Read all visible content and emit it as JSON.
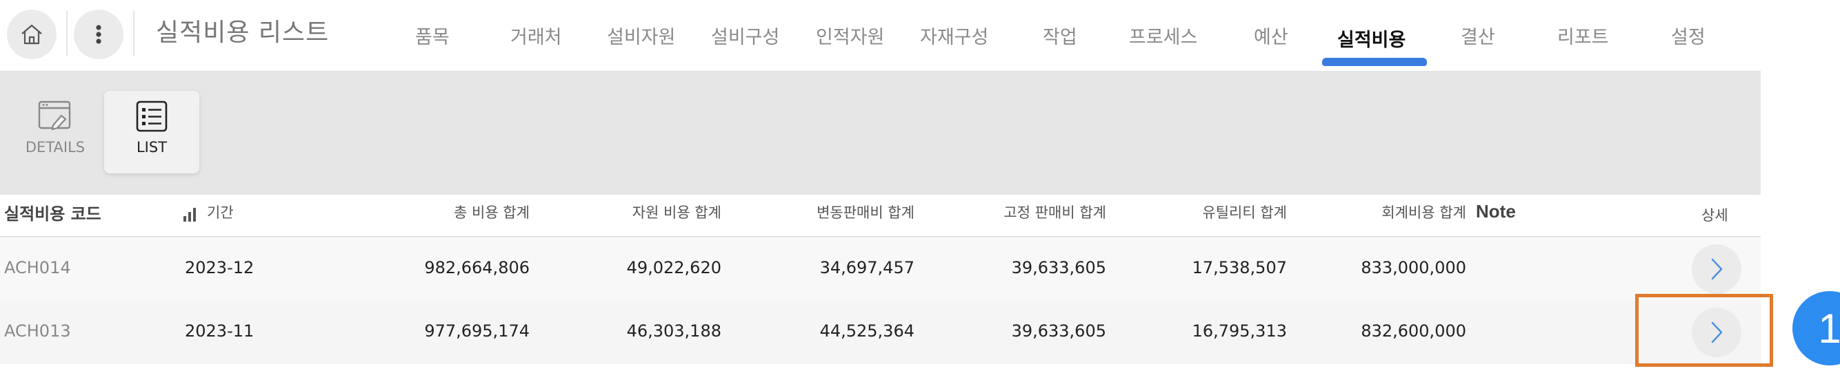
{
  "header": {
    "title": "실적비용 리스트",
    "home_icon": "home-icon",
    "menu_icon": "more-vertical-icon"
  },
  "nav": {
    "tabs": [
      {
        "label": "품목"
      },
      {
        "label": "거래처"
      },
      {
        "label": "설비자원"
      },
      {
        "label": "설비구성"
      },
      {
        "label": "인적자원"
      },
      {
        "label": "자재구성"
      },
      {
        "label": "작업"
      },
      {
        "label": "프로세스"
      },
      {
        "label": "예산"
      },
      {
        "label": "실적비용",
        "active": true
      },
      {
        "label": "결산"
      },
      {
        "label": "리포트"
      },
      {
        "label": "설정"
      }
    ],
    "accent_color": "#3a7be0"
  },
  "toolbar": {
    "details_label": "DETAILS",
    "list_label": "LIST",
    "details_icon": "details-window-icon",
    "list_icon": "list-icon",
    "active_view": "LIST"
  },
  "table": {
    "columns": {
      "code": "실적비용 코드",
      "period": "기간",
      "total": "총 비용 합계",
      "resource": "자원 비용 합계",
      "variable_sales": "변동판매비 합계",
      "fixed_sales": "고정 판매비 합계",
      "utility": "유틸리티 합계",
      "accounting": "회계비용 합계",
      "note": "Note",
      "detail": "상세"
    },
    "rows": [
      {
        "code": "ACH014",
        "period": "2023-12",
        "total": "982,664,806",
        "resource": "49,022,620",
        "variable_sales": "34,697,457",
        "fixed_sales": "39,633,605",
        "utility": "17,538,507",
        "accounting": "833,000,000"
      },
      {
        "code": "ACH013",
        "period": "2023-11",
        "total": "977,695,174",
        "resource": "46,303,188",
        "variable_sales": "44,525,364",
        "fixed_sales": "39,633,605",
        "utility": "16,795,313",
        "accounting": "832,600,000"
      }
    ]
  },
  "annotation": {
    "step_number": "1",
    "box_color": "#e07b2e",
    "badge_color": "#2d8cf0"
  }
}
